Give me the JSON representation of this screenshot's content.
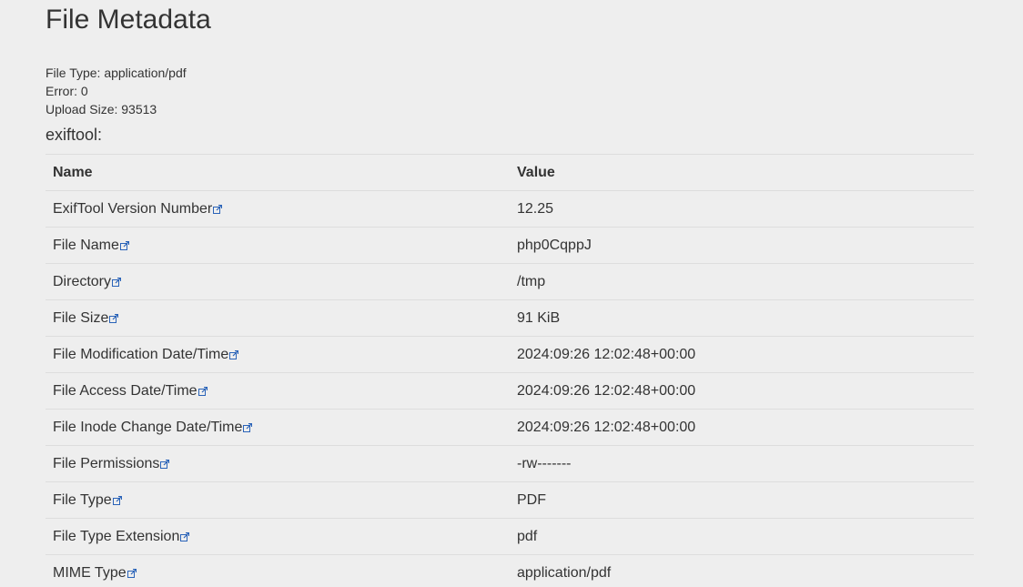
{
  "page": {
    "title": "File Metadata"
  },
  "upload": {
    "file_type": "File Type: application/pdf",
    "error": "Error: 0",
    "upload_size": "Upload Size: 93513"
  },
  "tool": {
    "label": "exiftool:"
  },
  "table": {
    "headers": {
      "name": "Name",
      "value": "Value"
    },
    "rows": [
      {
        "name": "ExifTool Version Number",
        "value": "12.25"
      },
      {
        "name": "File Name",
        "value": "php0CqppJ"
      },
      {
        "name": "Directory",
        "value": "/tmp"
      },
      {
        "name": "File Size",
        "value": "91 KiB"
      },
      {
        "name": "File Modification Date/Time",
        "value": "2024:09:26 12:02:48+00:00"
      },
      {
        "name": "File Access Date/Time",
        "value": "2024:09:26 12:02:48+00:00"
      },
      {
        "name": "File Inode Change Date/Time",
        "value": "2024:09:26 12:02:48+00:00"
      },
      {
        "name": "File Permissions",
        "value": "-rw-------"
      },
      {
        "name": "File Type",
        "value": "PDF"
      },
      {
        "name": "File Type Extension",
        "value": "pdf"
      },
      {
        "name": "MIME Type",
        "value": "application/pdf"
      }
    ]
  },
  "icons": {
    "link": "external-link-icon"
  },
  "colors": {
    "background": "#eeeeee",
    "text": "#333333",
    "link_icon": "#2a63b8",
    "row_border": "#dddddd"
  }
}
